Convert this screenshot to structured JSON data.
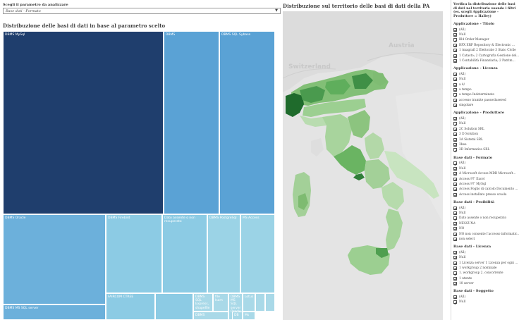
{
  "parameter": {
    "label": "Scegli il parametro da analizzare",
    "selected": "Base dati - Formato"
  },
  "treemap": {
    "title": "Distribuzione delle basi di dati in base al parametro scelto",
    "cells": [
      {
        "label": "DBMS MySql",
        "tone": "dark"
      },
      {
        "label": "DBMS",
        "tone": "mid"
      },
      {
        "label": "DBMS SQL Sybase",
        "tone": "mid"
      },
      {
        "label": "DBMS Oracle",
        "tone": "mid"
      },
      {
        "label": "DBMS Firebird",
        "tone": "light"
      },
      {
        "label": "Dato assente o non recuperato",
        "tone": "light"
      },
      {
        "label": "DBMS PostgreSql",
        "tone": "light"
      },
      {
        "label": "MS Access",
        "tone": "light"
      },
      {
        "label": "DBMS MS SQL server",
        "tone": "mid"
      },
      {
        "label": "FAIRCOM CTREE",
        "tone": "light"
      },
      {
        "label": "",
        "tone": "light"
      },
      {
        "label": "DBMS SQL Express, shapefile",
        "tone": "pale"
      },
      {
        "label": "file Isam",
        "tone": "pale"
      },
      {
        "label": "DBMS MS SQL server Oracle",
        "tone": "pale"
      },
      {
        "label": "Lotus",
        "tone": "pale"
      },
      {
        "label": "",
        "tone": "pale"
      },
      {
        "label": "",
        "tone": "pale"
      },
      {
        "label": "DBMS",
        "tone": "pale"
      },
      {
        "label": "DB",
        "tone": "pale"
      },
      {
        "label": "Ms",
        "tone": "pale"
      }
    ]
  },
  "map": {
    "title": "Distribuzione sul territorio delle basi di dati della PA",
    "labels": {
      "austria": "Austria",
      "switzerland": "Switzerland"
    }
  },
  "filters": {
    "intro": "Verifica la distribuzione delle basi di dati nel territorio usando i filtri (es. scegli Applicazione - Produttore = Halley)",
    "groups": [
      {
        "title": "Applicazione - Titolo",
        "items": [
          "(All)",
          "Null",
          "Bl4 Order Manager",
          "RPX ERP Repository & Electronic ...",
          "1 Anagrafi 2 Elettorale 3 Stato Civile",
          "1 Catasto; 2 Cartografia Gestione del...",
          "1 Contabilità Finanziaria; 2 Patrim..."
        ]
      },
      {
        "title": "Applicazione - Licenza",
        "items": [
          "(All)",
          "Null",
          "a 4/",
          "a tempo",
          "a tempo Indeterminato",
          "accesso tramite passwdusered",
          "singolare"
        ]
      },
      {
        "title": "Applicazione - Produttore",
        "items": [
          "(All)",
          "Null",
          "2C Solution SRL",
          "3 D Solution",
          "3A Sistemi SRL",
          "3bee",
          "3D Informatica SRL"
        ]
      },
      {
        "title": "Base dati - Formato",
        "items": [
          "(All)",
          "Null",
          "À Microsoft Access MDB Microsoft...",
          "Access 97' Excel",
          "Access 97' MySql",
          "Access Foglio di calcolo Documento ...",
          "Access installato presso scuola"
        ]
      },
      {
        "title": "Base dati - Proibilità",
        "items": [
          "(All)",
          "Null",
          "Dato assente o non recuperato",
          "NESSUNA",
          "NO",
          "NO non consente l'accesso informatic...",
          "non select"
        ]
      },
      {
        "title": "Base dati - Licenza",
        "items": [
          "(All)",
          "Null",
          "1 Licenza server 1 Licenza per ogni ...",
          "1 workgroup 2 nominale",
          "1. workgroup 2. concorrente",
          "1 utente",
          "10 server"
        ]
      },
      {
        "title": "Base dati - Soggetto",
        "items": [
          "(All)",
          "Null"
        ]
      }
    ]
  }
}
